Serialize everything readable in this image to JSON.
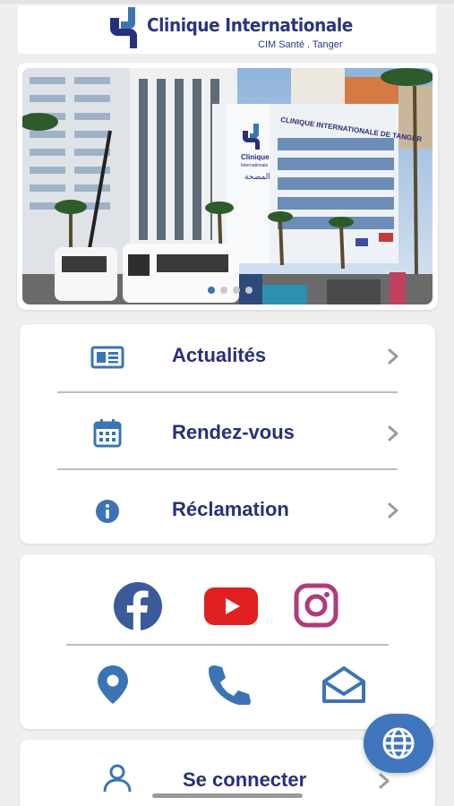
{
  "header": {
    "title": "Clinique Internationale",
    "subtitle": "CIM Santé . Tanger"
  },
  "hero": {
    "building_sign": "CLINIQUE INTERNATIONALE DE TANGER",
    "building_logo_text": "Clinique",
    "building_logo_sub": "Internationale",
    "building_logo_arabic": "المصحة",
    "slide_count": 4,
    "active_slide": 1
  },
  "menu": {
    "items": [
      {
        "label": "Actualités",
        "icon": "newspaper-icon"
      },
      {
        "label": "Rendez-vous",
        "icon": "calendar-icon"
      },
      {
        "label": "Réclamation",
        "icon": "info-icon"
      }
    ]
  },
  "social": {
    "row1": [
      "facebook-icon",
      "youtube-icon",
      "instagram-icon"
    ],
    "row2": [
      "location-pin-icon",
      "phone-icon",
      "mail-icon"
    ]
  },
  "login": {
    "label": "Se connecter",
    "icon": "user-icon"
  },
  "fab": {
    "icon": "globe-icon"
  },
  "colors": {
    "brand_navy": "#27307a",
    "brand_blue": "#3a74b5",
    "facebook": "#3a5a9a",
    "youtube": "#e02020",
    "instagram": "#b03a7a",
    "fab": "#3f76bd"
  }
}
